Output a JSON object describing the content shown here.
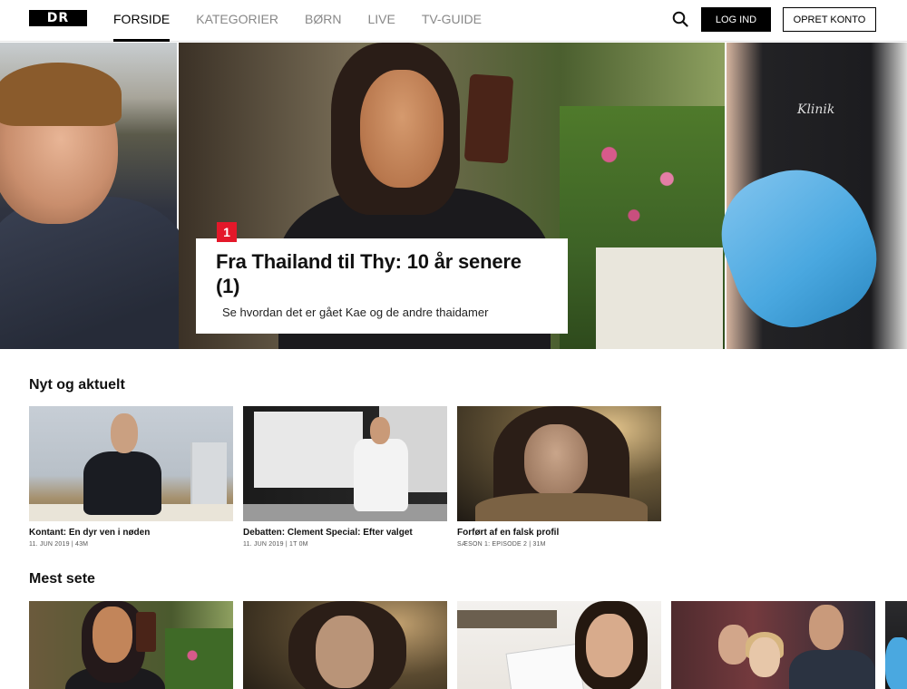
{
  "header": {
    "logo": "DR",
    "nav": [
      {
        "label": "FORSIDE",
        "active": true
      },
      {
        "label": "KATEGORIER",
        "active": false
      },
      {
        "label": "BØRN",
        "active": false
      },
      {
        "label": "LIVE",
        "active": false
      },
      {
        "label": "TV-GUIDE",
        "active": false
      }
    ],
    "search_icon": "search-icon",
    "login_label": "LOG IND",
    "signup_label": "OPRET KONTO"
  },
  "hero": {
    "rank": "1",
    "title": "Fra Thailand til Thy: 10 år senere (1)",
    "subtitle": "Se hvordan det er gået Kae og de andre thaidamer",
    "right_brand": "Klinik"
  },
  "sections": {
    "news": {
      "title": "Nyt og aktuelt",
      "items": [
        {
          "title": "Kontant: En dyr ven i nøden",
          "meta": "11. JUN 2019 | 43M"
        },
        {
          "title": "Debatten: Clement Special: Efter valget",
          "meta": "11. JUN 2019 | 1T 0M"
        },
        {
          "title": "Forført af en falsk profil",
          "meta": "SÆSON 1: EPISODE 2 | 31M"
        }
      ]
    },
    "most_viewed": {
      "title": "Mest sete"
    }
  },
  "colors": {
    "accent_red": "#e4182a",
    "text": "#111111",
    "header_bg": "#ffffff"
  }
}
